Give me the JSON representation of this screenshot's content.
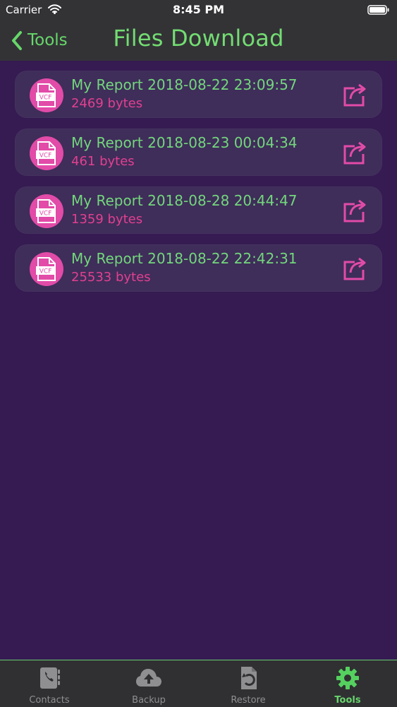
{
  "status_bar": {
    "carrier": "Carrier",
    "time": "8:45 PM"
  },
  "navigation": {
    "back_label": "Tools",
    "title": "Files Download"
  },
  "files": [
    {
      "name": "My Report 2018-08-22 23:09:57",
      "size": "2469 bytes",
      "icon_text": "VCF"
    },
    {
      "name": "My Report 2018-08-23 00:04:34",
      "size": "461 bytes",
      "icon_text": "VCF"
    },
    {
      "name": "My Report 2018-08-28 20:44:47",
      "size": "1359 bytes",
      "icon_text": "VCF"
    },
    {
      "name": "My Report 2018-08-22 22:42:31",
      "size": "25533 bytes",
      "icon_text": "VCF"
    }
  ],
  "tabs": [
    {
      "label": "Contacts",
      "icon": "contacts-icon",
      "active": false
    },
    {
      "label": "Backup",
      "icon": "cloud-upload-icon",
      "active": false
    },
    {
      "label": "Restore",
      "icon": "restore-icon",
      "active": false
    },
    {
      "label": "Tools",
      "icon": "gear-icon",
      "active": true
    }
  ],
  "colors": {
    "background": "#361a52",
    "toolbar": "#333336",
    "row": "#3f2d5a",
    "green": "#72d77b",
    "pink": "#e24ba8"
  }
}
